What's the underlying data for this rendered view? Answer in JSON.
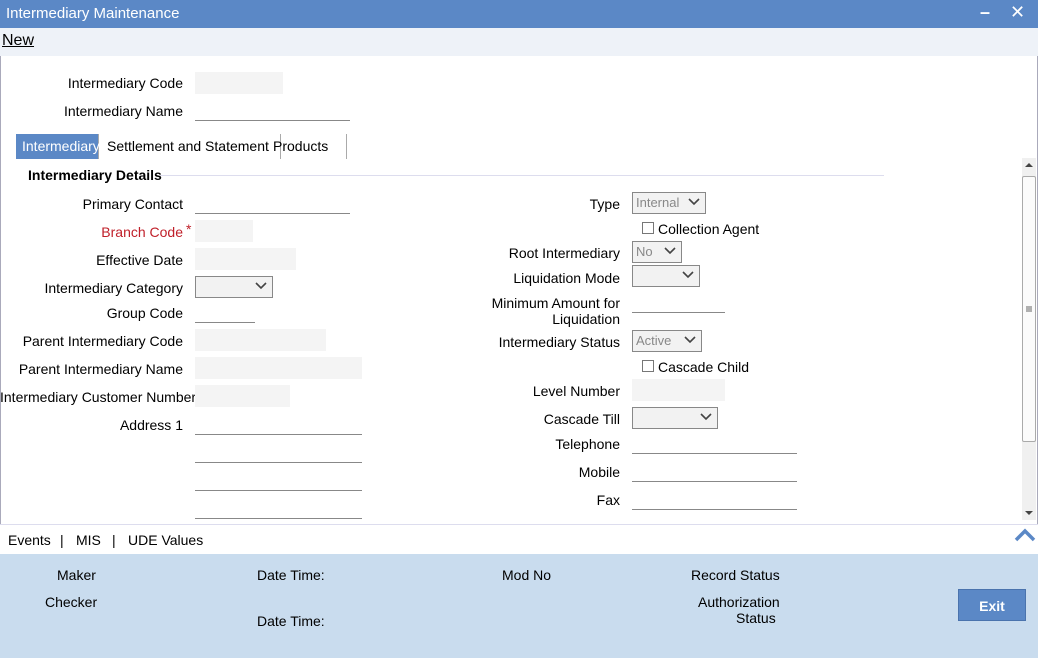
{
  "window": {
    "title": "Intermediary Maintenance",
    "minimize_glyph": "–",
    "close_glyph": "✕"
  },
  "menu": {
    "new_label": "New"
  },
  "header": {
    "intermediary_code_label": "Intermediary Code",
    "intermediary_name_label": "Intermediary Name"
  },
  "tabs": [
    {
      "label": "Intermediary"
    },
    {
      "label": "Settlement and Statement"
    },
    {
      "label": "Products"
    }
  ],
  "section": {
    "title": "Intermediary Details"
  },
  "left": {
    "primary_contact": "Primary Contact",
    "branch_code": "Branch Code",
    "required_mark": "*",
    "effective_date": "Effective Date",
    "intermediary_category": "Intermediary Category",
    "group_code": "Group Code",
    "parent_intermediary_code": "Parent Intermediary Code",
    "parent_intermediary_name": "Parent Intermediary Name",
    "intermediary_customer_number": "Intermediary Customer Number",
    "address1": "Address 1"
  },
  "right": {
    "type_label": "Type",
    "type_value": "Internal",
    "collection_agent": "Collection Agent",
    "root_intermediary_label": "Root Intermediary",
    "root_intermediary_value": "No",
    "liquidation_mode": "Liquidation Mode",
    "min_amount_line1": "Minimum Amount for",
    "min_amount_line2": "Liquidation",
    "intermediary_status_label": "Intermediary Status",
    "intermediary_status_value": "Active",
    "cascade_child": "Cascade Child",
    "level_number": "Level Number",
    "cascade_till": "Cascade Till",
    "telephone": "Telephone",
    "mobile": "Mobile",
    "fax": "Fax"
  },
  "bottom_links": {
    "events": "Events",
    "sep": "|",
    "mis": "MIS",
    "udf": "UDE Values"
  },
  "footer": {
    "maker": "Maker",
    "checker": "Checker",
    "date_time": "Date Time:",
    "mod_no": "Mod No",
    "record_status": "Record Status",
    "auth_line1": "Authorization",
    "auth_line2": "Status",
    "exit": "Exit"
  },
  "colors": {
    "accent": "#5b88c6",
    "footer_bg": "#c9dcee",
    "required": "#c0202a"
  }
}
